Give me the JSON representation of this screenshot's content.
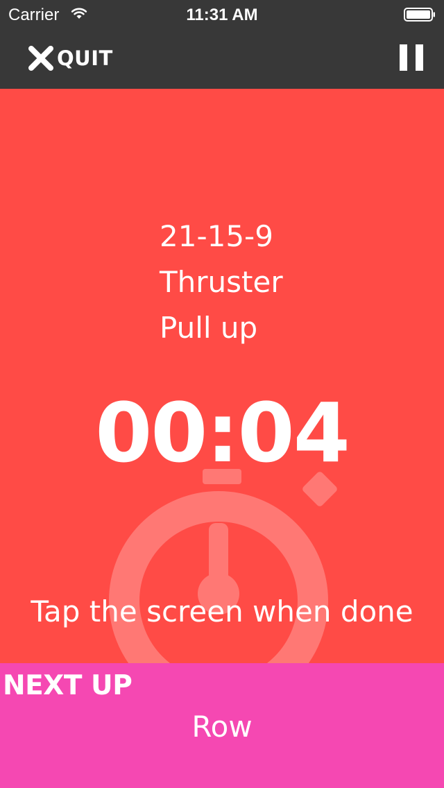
{
  "status_bar": {
    "carrier": "Carrier",
    "time": "11:31 AM",
    "wifi_icon": "wifi-icon",
    "battery_icon": "battery-icon"
  },
  "nav": {
    "quit_label": "QUIT",
    "quit_icon": "close-icon",
    "pause_icon": "pause-icon"
  },
  "workout": {
    "lines": [
      "21-15-9",
      "Thruster",
      "Pull up"
    ],
    "timer": "00:04",
    "hint": "Tap the screen when done",
    "background_icon": "stopwatch-icon"
  },
  "next_up": {
    "title": "NEXT UP",
    "exercise": "Row"
  },
  "colors": {
    "bar_background": "#383838",
    "workout_background": "#ff4b46",
    "next_up_background": "#f548b2",
    "text": "#ffffff"
  }
}
